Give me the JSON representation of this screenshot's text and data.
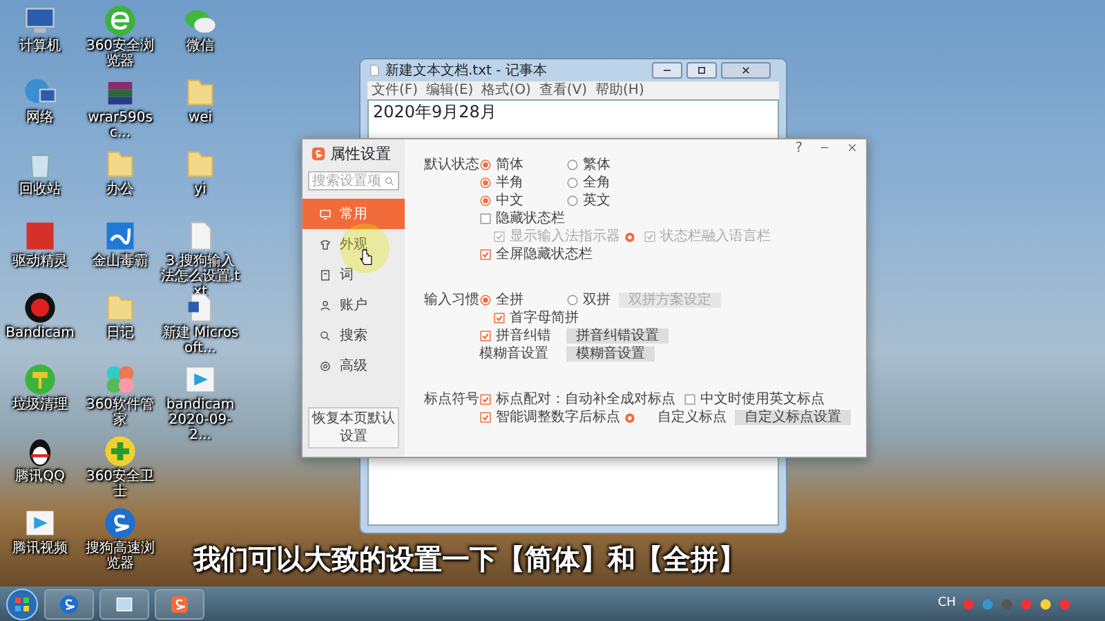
{
  "desktop_icons": [
    {
      "label": "计算机",
      "kind": "computer"
    },
    {
      "label": "网络",
      "kind": "network"
    },
    {
      "label": "回收站",
      "kind": "recycle"
    },
    {
      "label": "驱动精灵",
      "kind": "driver"
    },
    {
      "label": "Bandicam",
      "kind": "recorder"
    },
    {
      "label": "垃圾清理",
      "kind": "cleaner"
    },
    {
      "label": "腾讯QQ",
      "kind": "qq"
    },
    {
      "label": "腾讯视频",
      "kind": "video"
    },
    {
      "label": "360安全浏览器",
      "kind": "browser"
    },
    {
      "label": "wrar590sc...",
      "kind": "archive"
    },
    {
      "label": "办公",
      "kind": "folder"
    },
    {
      "label": "金山毒霸",
      "kind": "antivirus"
    },
    {
      "label": "日记",
      "kind": "folder"
    },
    {
      "label": "360软件管家",
      "kind": "apps"
    },
    {
      "label": "360安全卫士",
      "kind": "guard"
    },
    {
      "label": "搜狗高速浏览器",
      "kind": "sogou"
    },
    {
      "label": "微信",
      "kind": "chat"
    },
    {
      "label": "wei",
      "kind": "folder"
    },
    {
      "label": "yi",
      "kind": "folder"
    },
    {
      "label": "3.搜狗输入法怎么设置.txt",
      "kind": "textfile"
    },
    {
      "label": "新建 Microsoft...",
      "kind": "doc"
    },
    {
      "label": "bandicam 2020-09-2...",
      "kind": "video"
    }
  ],
  "notepad": {
    "title": "新建文本文档.txt - 记事本",
    "menu": [
      "文件(F)",
      "编辑(E)",
      "格式(O)",
      "查看(V)",
      "帮助(H)"
    ],
    "text": "2020年9月28月"
  },
  "settings": {
    "title": "属性设置",
    "help_button": "?",
    "search": {
      "placeholder": "搜索设置项"
    },
    "nav": [
      {
        "label": "常用",
        "selected": true
      },
      {
        "label": "外观",
        "selected": false
      },
      {
        "label": "词",
        "selected": false
      },
      {
        "label": "账户",
        "selected": false
      },
      {
        "label": "搜索",
        "selected": false
      },
      {
        "label": "高级",
        "selected": false
      }
    ],
    "reset_button": "恢复本页默认设置",
    "sections": [
      {
        "heading": "默认状态",
        "rows": [
          {
            "indent": false,
            "items": [
              {
                "kind": "radio",
                "label": "简体",
                "selected": true
              },
              {
                "kind": "radio",
                "label": "繁体",
                "selected": false
              }
            ]
          },
          {
            "indent": false,
            "items": [
              {
                "kind": "radio",
                "label": "半角",
                "selected": true
              },
              {
                "kind": "radio",
                "label": "全角",
                "selected": false
              }
            ]
          },
          {
            "indent": false,
            "items": [
              {
                "kind": "radio",
                "label": "中文",
                "selected": true
              },
              {
                "kind": "radio",
                "label": "英文",
                "selected": false
              }
            ]
          },
          {
            "indent": false,
            "items": [
              {
                "kind": "checkbox",
                "label": "隐藏状态栏",
                "checked": false,
                "disabled": false
              }
            ]
          },
          {
            "indent": true,
            "items": [
              {
                "kind": "checkbox",
                "label": "显示输入法指示器",
                "checked": true,
                "disabled": true,
                "help": true
              },
              {
                "kind": "checkbox",
                "label": "状态栏融入语言栏",
                "checked": true,
                "disabled": true
              }
            ]
          },
          {
            "indent": false,
            "items": [
              {
                "kind": "checkbox",
                "label": "全屏隐藏状态栏",
                "checked": true,
                "disabled": false
              }
            ]
          }
        ]
      },
      {
        "heading": "输入习惯",
        "rows": [
          {
            "indent": false,
            "items": [
              {
                "kind": "radio",
                "label": "全拼",
                "selected": true
              },
              {
                "kind": "radio",
                "label": "双拼",
                "selected": false
              },
              {
                "kind": "button",
                "label": "双拼方案设定",
                "disabled": true
              }
            ]
          },
          {
            "indent": true,
            "items": [
              {
                "kind": "checkbox",
                "label": "首字母简拼",
                "checked": true,
                "disabled": false
              }
            ]
          },
          {
            "indent": false,
            "items": [
              {
                "kind": "checkbox",
                "label": "拼音纠错",
                "checked": true,
                "disabled": false
              },
              {
                "kind": "button",
                "label": "拼音纠错设置",
                "disabled": false
              }
            ]
          },
          {
            "indent": false,
            "items": [
              {
                "kind": "label",
                "label": "模糊音设置"
              },
              {
                "kind": "button",
                "label": "模糊音设置",
                "disabled": false
              }
            ]
          }
        ]
      },
      {
        "heading": "标点符号",
        "rows": [
          {
            "indent": false,
            "items": [
              {
                "kind": "checkbox",
                "label": "标点配对：自动补全成对标点",
                "checked": true,
                "disabled": false
              },
              {
                "kind": "checkbox",
                "label": "中文时使用英文标点",
                "checked": false,
                "disabled": false
              }
            ]
          },
          {
            "indent": false,
            "items": [
              {
                "kind": "checkbox",
                "label": "智能调整数字后标点",
                "checked": true,
                "disabled": false,
                "help": true
              },
              {
                "kind": "label",
                "label": "自定义标点"
              },
              {
                "kind": "button",
                "label": "自定义标点设置",
                "disabled": false
              }
            ]
          }
        ]
      }
    ]
  },
  "caption": "我们可以大致的设置一下【简体】和【全拼】",
  "tray": {
    "language": "CH"
  }
}
